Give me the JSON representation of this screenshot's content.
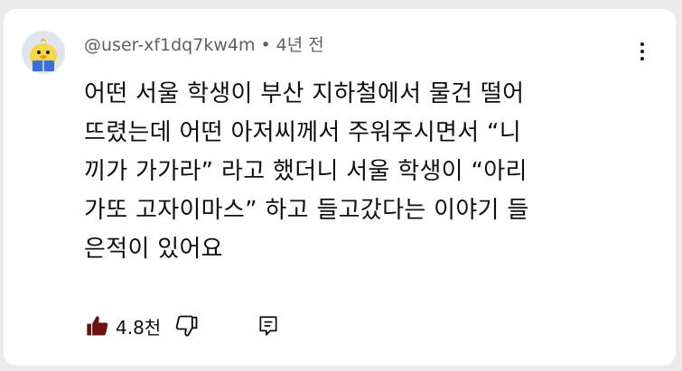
{
  "comment": {
    "author": "@user-xf1dq7kw4m",
    "separator": "•",
    "time": "4년 전",
    "text": "어떤 서울 학생이 부산 지하철에서 물건 떨어\n뜨렸는데 어떤 아저씨께서 주워주시면서 “니\n끼가 가가라” 라고 했더니 서울 학생이 “아리\n가또 고자이마스” 하고 들고갔다는 이야기 들\n은적이 있어요",
    "like_count": "4.8천"
  },
  "icons": {
    "avatar": "duck-avatar",
    "more": "more-vertical-icon",
    "like": "thumbs-up-filled-icon",
    "dislike": "thumbs-down-outline-icon",
    "reply": "comment-reply-icon"
  },
  "colors": {
    "background": "#ebebeb",
    "card": "#ffffff",
    "text_primary": "#0f0f0f",
    "text_secondary": "#606060",
    "like_icon": "#6b1313"
  }
}
